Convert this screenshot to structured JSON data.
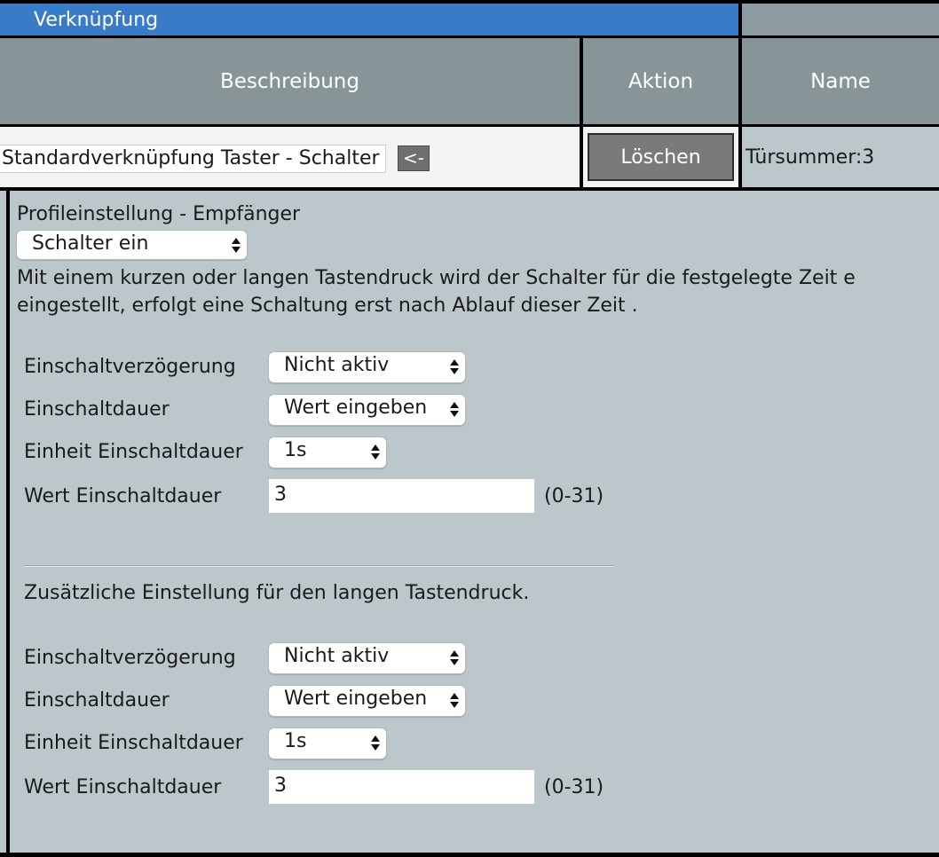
{
  "title": "Verknüpfung",
  "header": {
    "col_description": "Beschreibung",
    "col_action": "Aktion",
    "col_name": "Name"
  },
  "row": {
    "description_value": "Standardverknüpfung Taster  - Schalter",
    "arrow_button": "<-",
    "delete_button": "Löschen",
    "name": "Türsummer:3"
  },
  "profile": {
    "label": "Profileinstellung - Empfänger",
    "selected": "Schalter ein",
    "description_line1": "Mit einem kurzen oder langen Tastendruck wird der Schalter für die festgelegte Zeit e",
    "description_line2": "eingestellt, erfolgt eine Schaltung erst nach Ablauf dieser Zeit ."
  },
  "short_press": {
    "delay_label": "Einschaltverzögerung",
    "delay_value": "Nicht aktiv",
    "duration_label": "Einschaltdauer",
    "duration_value": "Wert eingeben",
    "unit_label": "Einheit Einschaltdauer",
    "unit_value": "1s",
    "value_label": "Wert Einschaltdauer",
    "value": "3",
    "range": "(0-31)"
  },
  "long_press_heading": "Zusätzliche Einstellung für den langen Tastendruck.",
  "long_press": {
    "delay_label": "Einschaltverzögerung",
    "delay_value": "Nicht aktiv",
    "duration_label": "Einschaltdauer",
    "duration_value": "Wert eingeben",
    "unit_label": "Einheit Einschaltdauer",
    "unit_value": "1s",
    "value_label": "Wert Einschaltdauer",
    "value": "3",
    "range": "(0-31)"
  },
  "icons": {
    "select_caret": "updown-caret-icon"
  }
}
